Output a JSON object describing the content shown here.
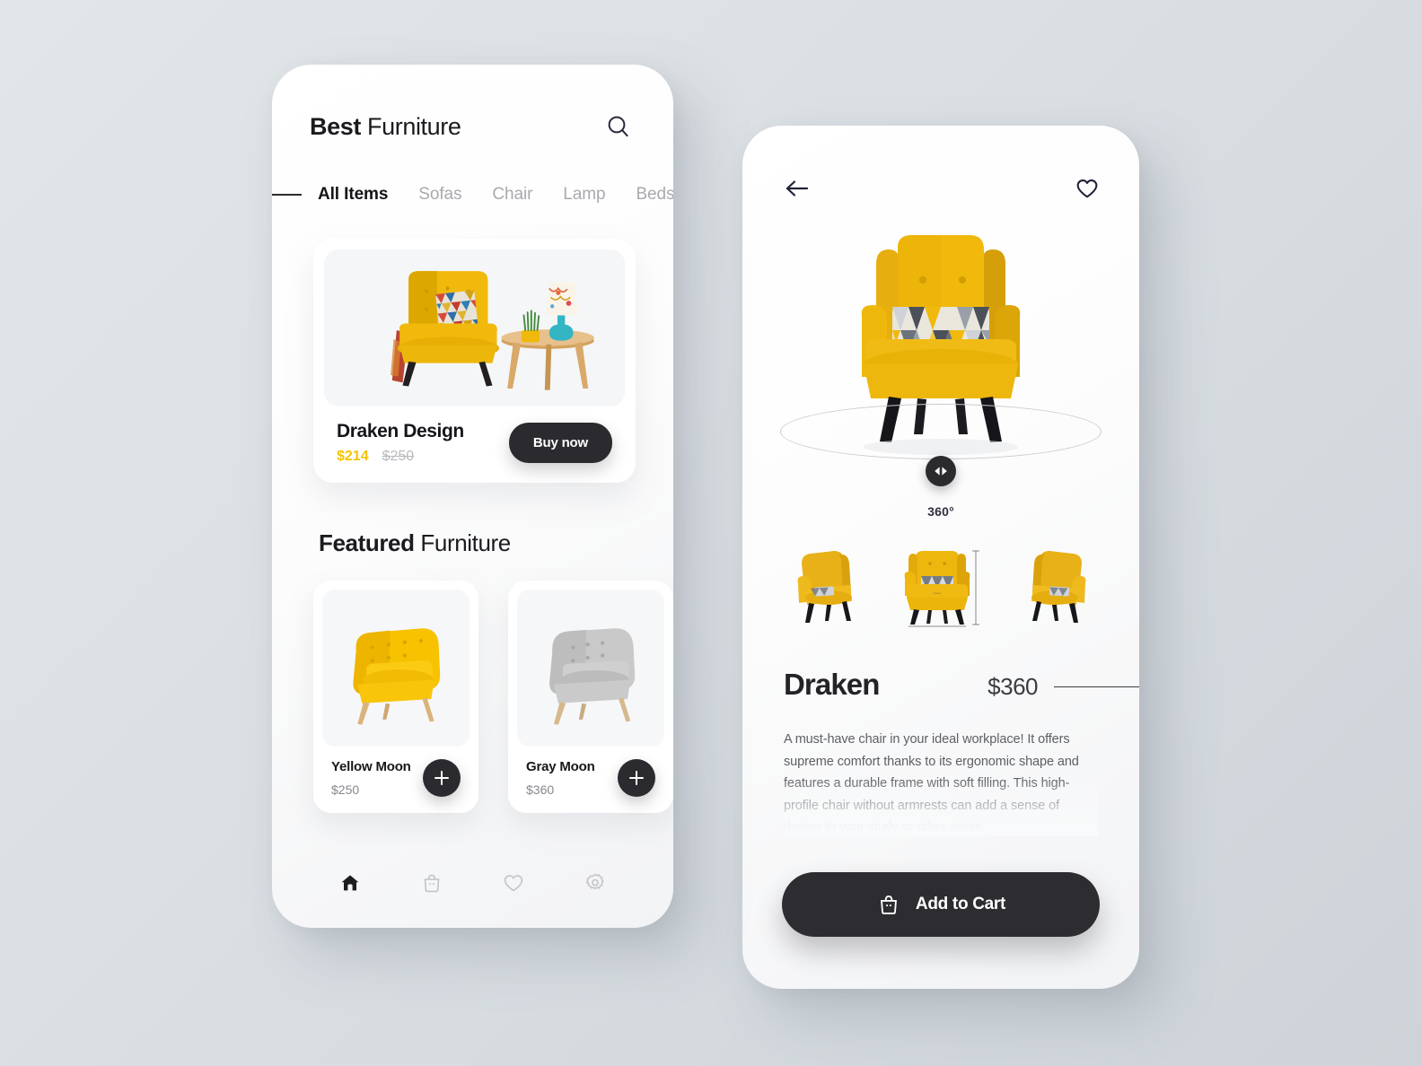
{
  "home": {
    "brand_bold": "Best",
    "brand_rest": " Furniture",
    "search_icon": "search-icon",
    "tabs": [
      {
        "label": "All Items",
        "active": true
      },
      {
        "label": "Sofas",
        "active": false
      },
      {
        "label": "Chair",
        "active": false
      },
      {
        "label": "Lamp",
        "active": false
      },
      {
        "label": "Beds",
        "active": false
      }
    ],
    "hero": {
      "title": "Draken Design",
      "price": "$214",
      "price_old": "$250",
      "buy_label": "Buy now",
      "image_alt": "yellow-armchair-with-side-table"
    },
    "featured": {
      "heading_bold": "Featured",
      "heading_rest": " Furniture",
      "items": [
        {
          "name": "Yellow Moon",
          "price": "$250",
          "add_label": "+",
          "image_alt": "yellow-armchair"
        },
        {
          "name": "Gray Moon",
          "price": "$360",
          "add_label": "+",
          "image_alt": "gray-armchair"
        }
      ]
    },
    "nav": [
      {
        "icon": "home-icon",
        "active": true
      },
      {
        "icon": "bag-icon",
        "active": false
      },
      {
        "icon": "heart-icon",
        "active": false
      },
      {
        "icon": "gear-icon",
        "active": false
      }
    ]
  },
  "detail": {
    "back_icon": "arrow-left-icon",
    "favorite_icon": "heart-icon",
    "rotate_label": "360°",
    "rotate_icon": "rotate-left-right-icon",
    "thumbnails": [
      {
        "alt": "chair-view-left"
      },
      {
        "alt": "chair-view-front-dimensions"
      },
      {
        "alt": "chair-view-right"
      }
    ],
    "product_name": "Draken",
    "product_price": "$360",
    "description": "A must-have chair in your ideal workplace! It offers supreme comfort thanks to its ergonomic shape and features a durable frame with soft filling. This high-profile chair without armrests can add a sense of design to your study or other areas.",
    "cart_label": "Add to Cart",
    "cart_icon": "bag-icon"
  },
  "colors": {
    "accent_yellow": "#f5c400",
    "dark": "#2b2b2f",
    "muted": "#a9aaae",
    "background": "#dfe3e6"
  }
}
